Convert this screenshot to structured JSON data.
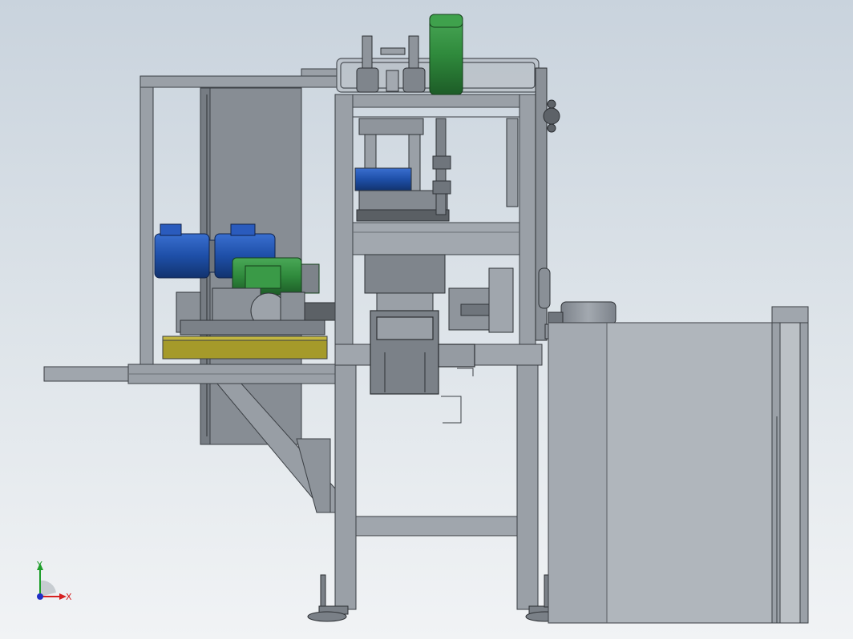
{
  "viewport": {
    "background_top": "#c9d3dd",
    "background_bottom": "#f1f3f5"
  },
  "model": {
    "frame_color": "#8e949b",
    "panel_color": "#8d949b",
    "motor_blue": "#1e4fa8",
    "motor_green": "#2f8a3c",
    "yellow_base": "#a59a2a"
  },
  "triad": {
    "y_label": "Y",
    "x_label": "X",
    "x_color": "#d62020",
    "y_color": "#1e9e2a",
    "z_color": "#1f2fc6"
  }
}
